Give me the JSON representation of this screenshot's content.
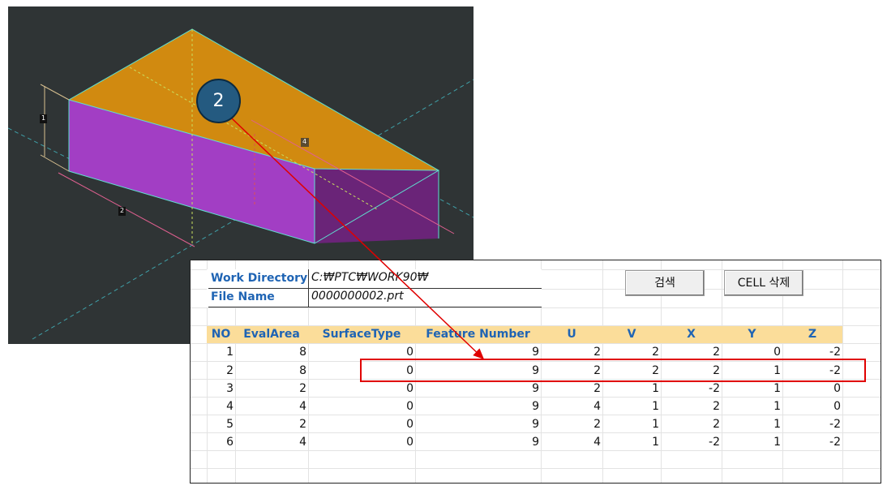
{
  "viewport": {
    "dimension_labels": [
      "1",
      "2",
      "4"
    ]
  },
  "callout": {
    "number": "2"
  },
  "sheet": {
    "work_directory_label": "Work Directory",
    "work_directory_value": "C:₩PTC₩WORK90₩",
    "file_name_label": "File Name",
    "file_name_value": "0000000002.prt",
    "search_button": "검색",
    "delete_cell_button": "CELL 삭제",
    "headers": [
      "NO",
      "EvalArea",
      "SurfaceType",
      "Feature Number",
      "U",
      "V",
      "X",
      "Y",
      "Z"
    ],
    "rows": [
      [
        "1",
        "8",
        "0",
        "9",
        "2",
        "2",
        "2",
        "0",
        "-2"
      ],
      [
        "2",
        "8",
        "0",
        "9",
        "2",
        "2",
        "2",
        "1",
        "-2"
      ],
      [
        "3",
        "2",
        "0",
        "9",
        "2",
        "1",
        "-2",
        "1",
        "0"
      ],
      [
        "4",
        "4",
        "0",
        "9",
        "4",
        "1",
        "2",
        "1",
        "0"
      ],
      [
        "5",
        "2",
        "0",
        "9",
        "2",
        "1",
        "2",
        "1",
        "-2"
      ],
      [
        "6",
        "4",
        "0",
        "9",
        "4",
        "1",
        "-2",
        "1",
        "-2"
      ]
    ],
    "highlighted_row": 2
  },
  "colors": {
    "viewport_bg": "#2f3435",
    "box_top": "#d18a10",
    "box_front": "#a23ec4",
    "box_side": "#6a2478",
    "header_band": "#fbdd9a",
    "label_blue": "#1f64b4",
    "highlight_red": "#e00000",
    "callout_fill": "#245a80"
  }
}
